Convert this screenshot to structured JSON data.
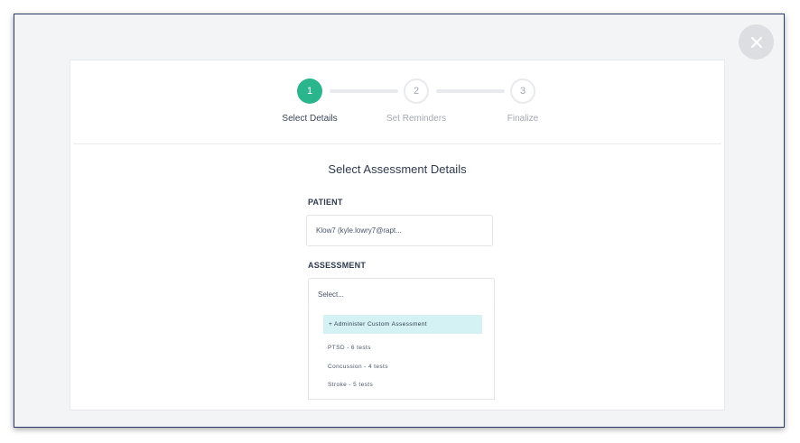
{
  "stepper": {
    "steps": [
      {
        "number": "1",
        "label": "Select Details"
      },
      {
        "number": "2",
        "label": "Set Reminders"
      },
      {
        "number": "3",
        "label": "Finalize"
      }
    ]
  },
  "form": {
    "title": "Select Assessment Details",
    "patient_label": "PATIENT",
    "patient_value": "Klow7 (kyle.lowry7@rapt...",
    "assessment_label": "ASSESSMENT",
    "assessment_placeholder": "Select...",
    "options": [
      {
        "label": "+ Administer Custom Assessment"
      },
      {
        "label": "PTSD - 6 tests"
      },
      {
        "label": "Concussion - 4 tests"
      },
      {
        "label": "Stroke - 5 tests"
      }
    ]
  },
  "colors": {
    "accent": "#2bb58c",
    "highlight": "#d4f1f4"
  },
  "icons": {
    "close": "close-icon"
  }
}
